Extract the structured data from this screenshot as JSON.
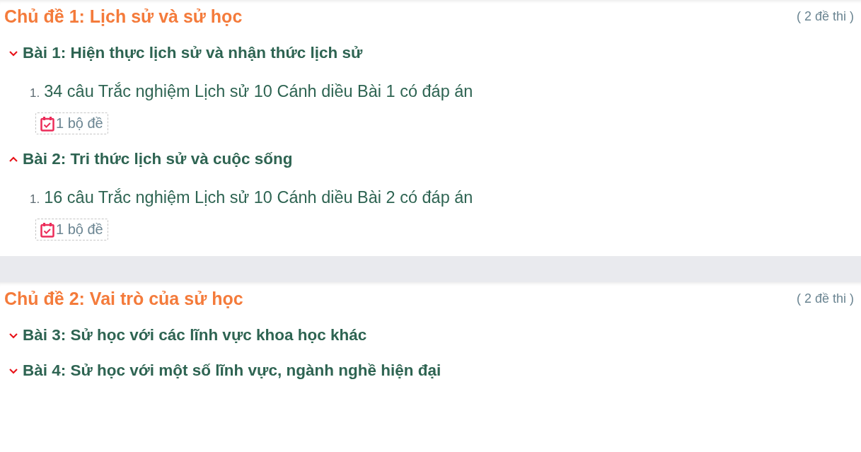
{
  "topics": [
    {
      "title": "Chủ đề 1: Lịch sử và sử học",
      "count": "( 2 đề thi )",
      "lessons": [
        {
          "title": "Bài 1: Hiện thực lịch sử và nhận thức lịch sử",
          "kind": "down",
          "items": [
            {
              "number": "1.",
              "title": "34 câu Trắc nghiệm Lịch sử 10 Cánh diều Bài 1 có đáp án",
              "badge": "1 bộ đề"
            }
          ]
        },
        {
          "title": "Bài 2: Tri thức lịch sử và cuộc sống",
          "kind": "up",
          "items": [
            {
              "number": "1.",
              "title": "16 câu Trắc nghiệm Lịch sử 10 Cánh diều Bài 2 có đáp án",
              "badge": "1 bộ đề"
            }
          ]
        }
      ]
    },
    {
      "title": "Chủ đề 2: Vai trò của sử học",
      "count": "( 2 đề thi )",
      "lessons": [
        {
          "title": "Bài 3: Sử học với các lĩnh vực khoa học khác",
          "kind": "down"
        },
        {
          "title": "Bài 4: Sử học với một số lĩnh vực, ngành nghề hiện đại",
          "kind": "down"
        }
      ]
    }
  ]
}
